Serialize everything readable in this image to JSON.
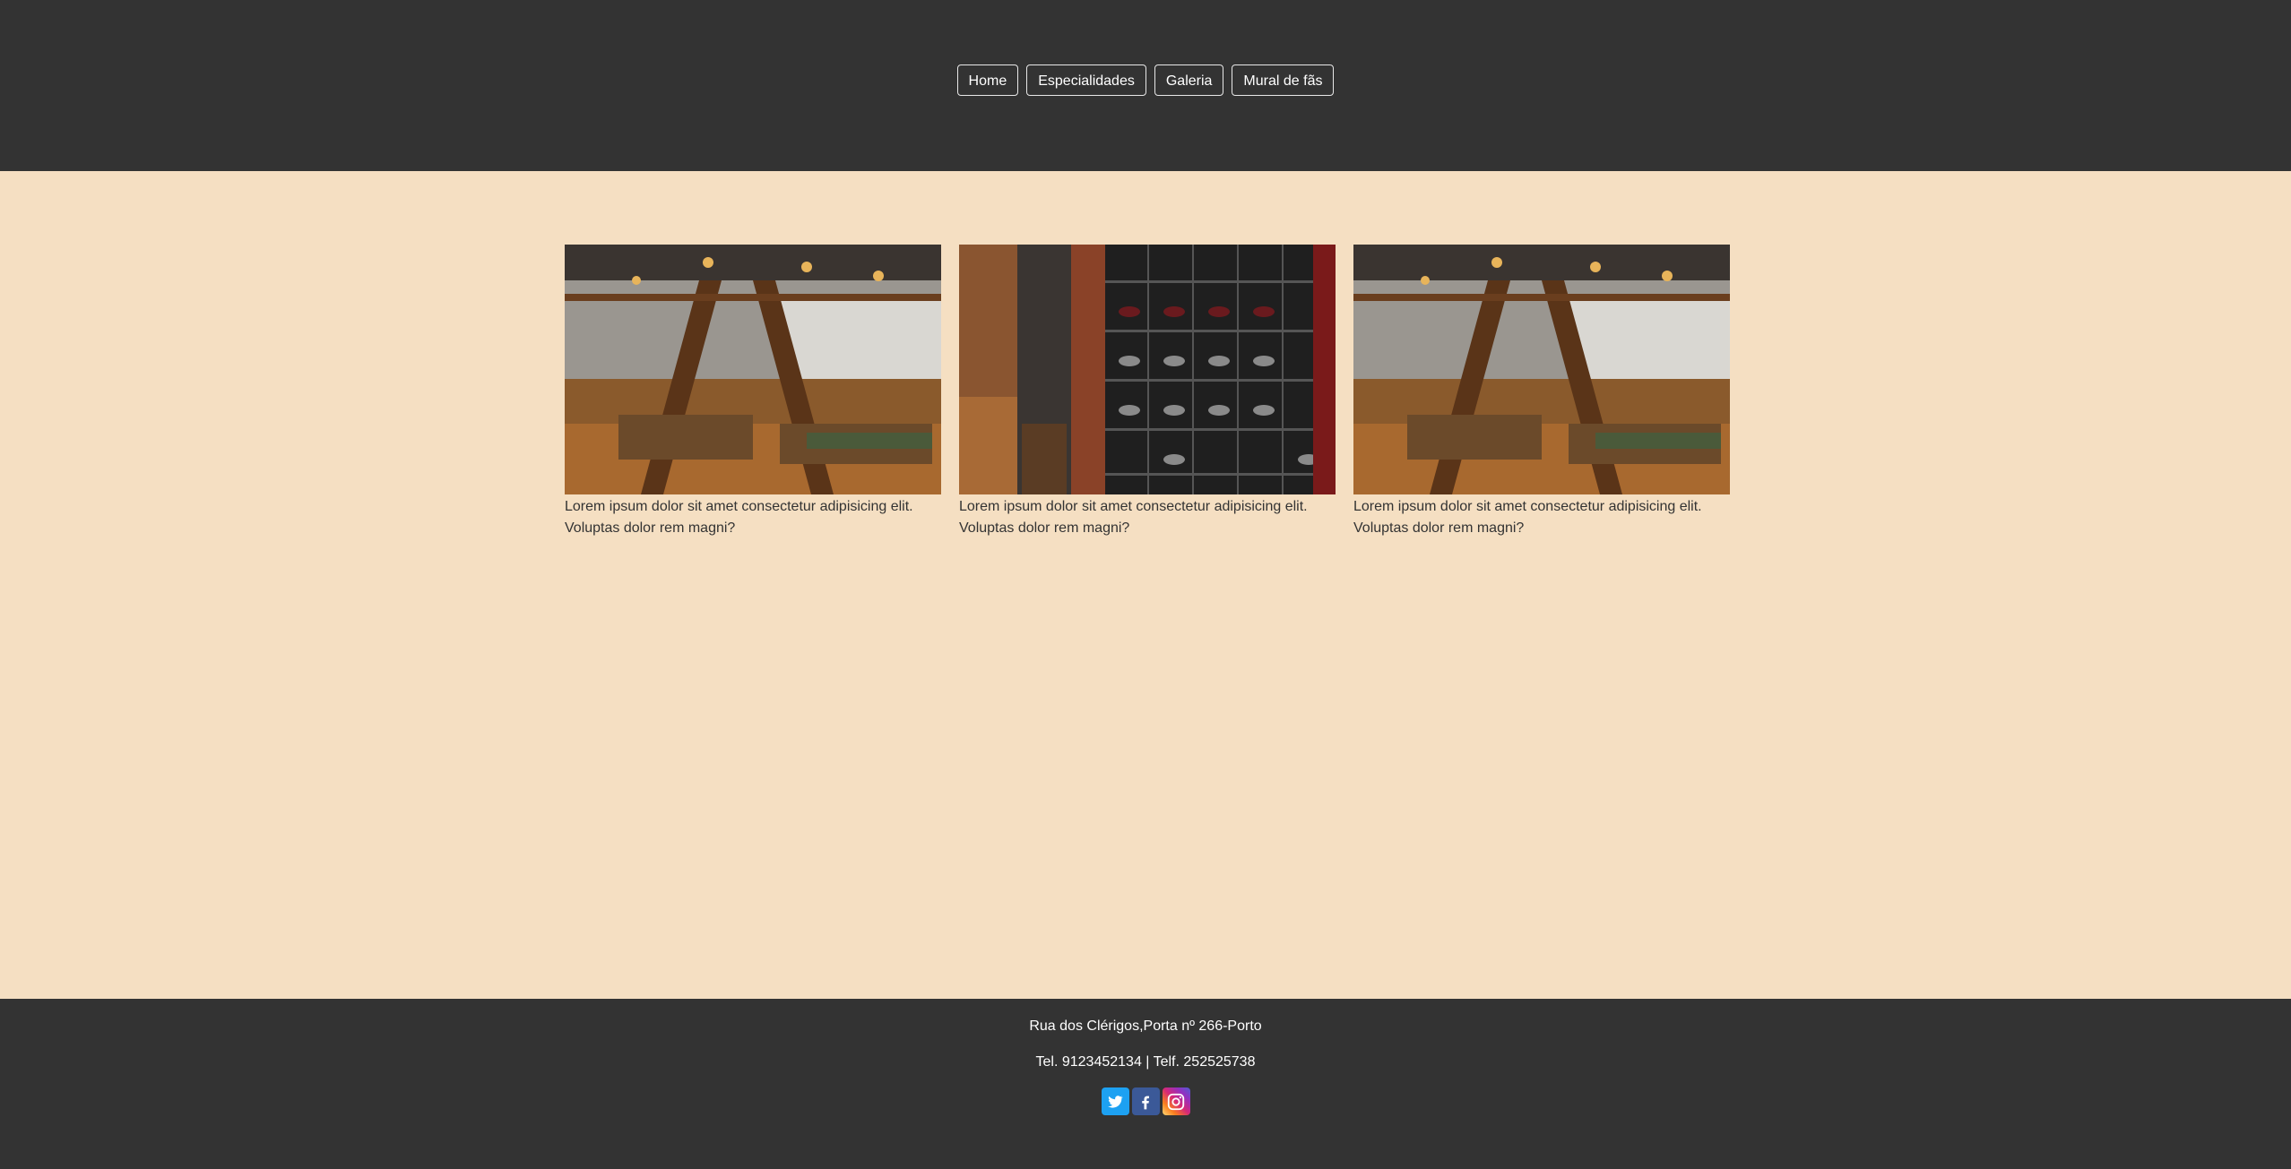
{
  "nav": {
    "items": [
      {
        "label": "Home"
      },
      {
        "label": "Especialidades"
      },
      {
        "label": "Galeria"
      },
      {
        "label": "Mural de fãs"
      }
    ]
  },
  "gallery": {
    "cards": [
      {
        "image": "restaurant-interior-photo",
        "caption": "Lorem ipsum dolor sit amet consectetur adipisicing elit. Voluptas dolor rem magni?"
      },
      {
        "image": "wine-cellar-photo",
        "caption": "Lorem ipsum dolor sit amet consectetur adipisicing elit. Voluptas dolor rem magni?"
      },
      {
        "image": "restaurant-interior-photo",
        "caption": "Lorem ipsum dolor sit amet consectetur adipisicing elit. Voluptas dolor rem magni?"
      }
    ]
  },
  "footer": {
    "address": "Rua dos Clérigos,Porta nº 266-Porto",
    "phones": "Tel. 9123452134 | Telf. 252525738",
    "social": [
      {
        "name": "twitter-icon",
        "color": "#1da1f2"
      },
      {
        "name": "facebook-icon",
        "color": "#3b5998"
      },
      {
        "name": "instagram-icon",
        "color": "#d62976"
      }
    ]
  },
  "colors": {
    "header_bg": "#333333",
    "main_bg": "#f5dfc2",
    "text": "#333333"
  }
}
